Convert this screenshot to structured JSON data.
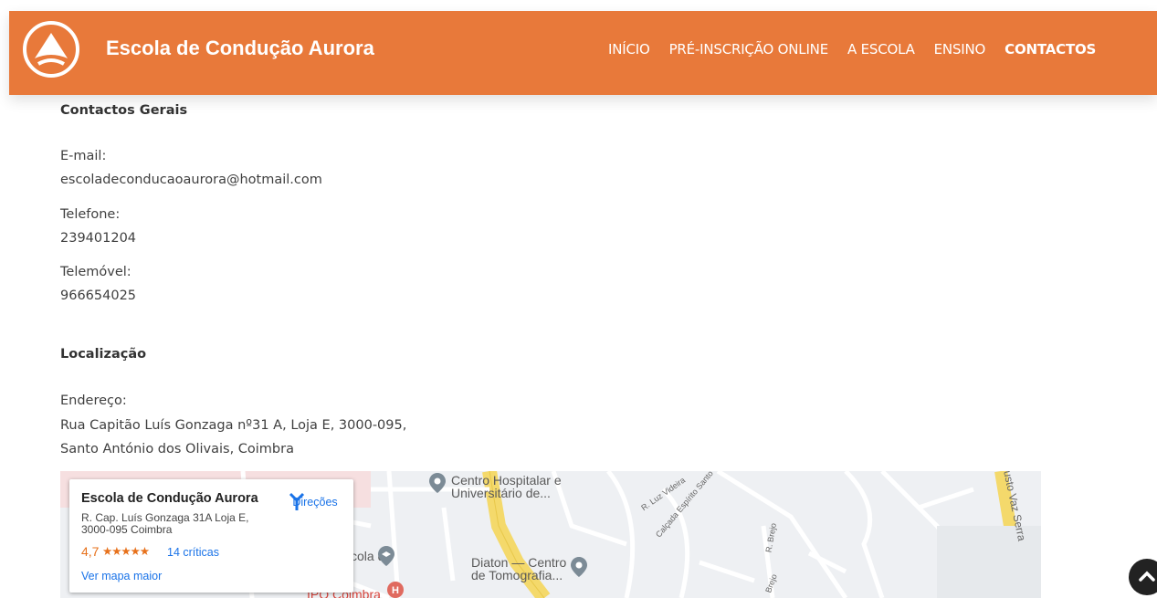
{
  "header": {
    "brand": "Escola de Condução Aurora",
    "nav": [
      "INÍCIO",
      "PRÉ-INSCRIÇÃO ONLINE",
      "A ESCOLA",
      "ENSINO",
      "CONTACTOS"
    ],
    "active_nav": "CONTACTOS",
    "accent_color": "#e8793a"
  },
  "contacts": {
    "heading": "Contactos Gerais",
    "email_label": "E-mail:",
    "email": "escoladeconducaoaurora@hotmail.com",
    "phone_label": "Telefone:",
    "phone": "239401204",
    "mobile_label": "Telemóvel:",
    "mobile": "966654025"
  },
  "location": {
    "heading": "Localização",
    "address_label": "Endereço:",
    "address_line1": "Rua Capitão Luís Gonzaga nº31 A, Loja E, 3000-095,",
    "address_line2": "Santo António dos Olivais, Coimbra"
  },
  "map": {
    "card_title": "Escola de Condução Aurora",
    "card_address": "R. Cap. Luís Gonzaga 31A Loja E, 3000-095 Coimbra",
    "rating": "4,7",
    "stars": "★★★★★",
    "reviews": "14 críticas",
    "directions": "Direções",
    "larger_map": "Ver mapa maior",
    "places": [
      "Centro Hospitalar e Universitário de...",
      "Diaton — Centro de Tomografia...",
      "IPO Coimbra",
      "cola de..."
    ],
    "streets": [
      "R. Luz Videira",
      "Calçada Espírito Santo",
      "R. Brejo",
      "Brejo",
      "gusto Vaz Serra"
    ]
  },
  "icons": [
    "logo-icon",
    "directions-icon",
    "map-pin-icon",
    "hospital-icon",
    "school-icon",
    "chevron-up-icon"
  ]
}
